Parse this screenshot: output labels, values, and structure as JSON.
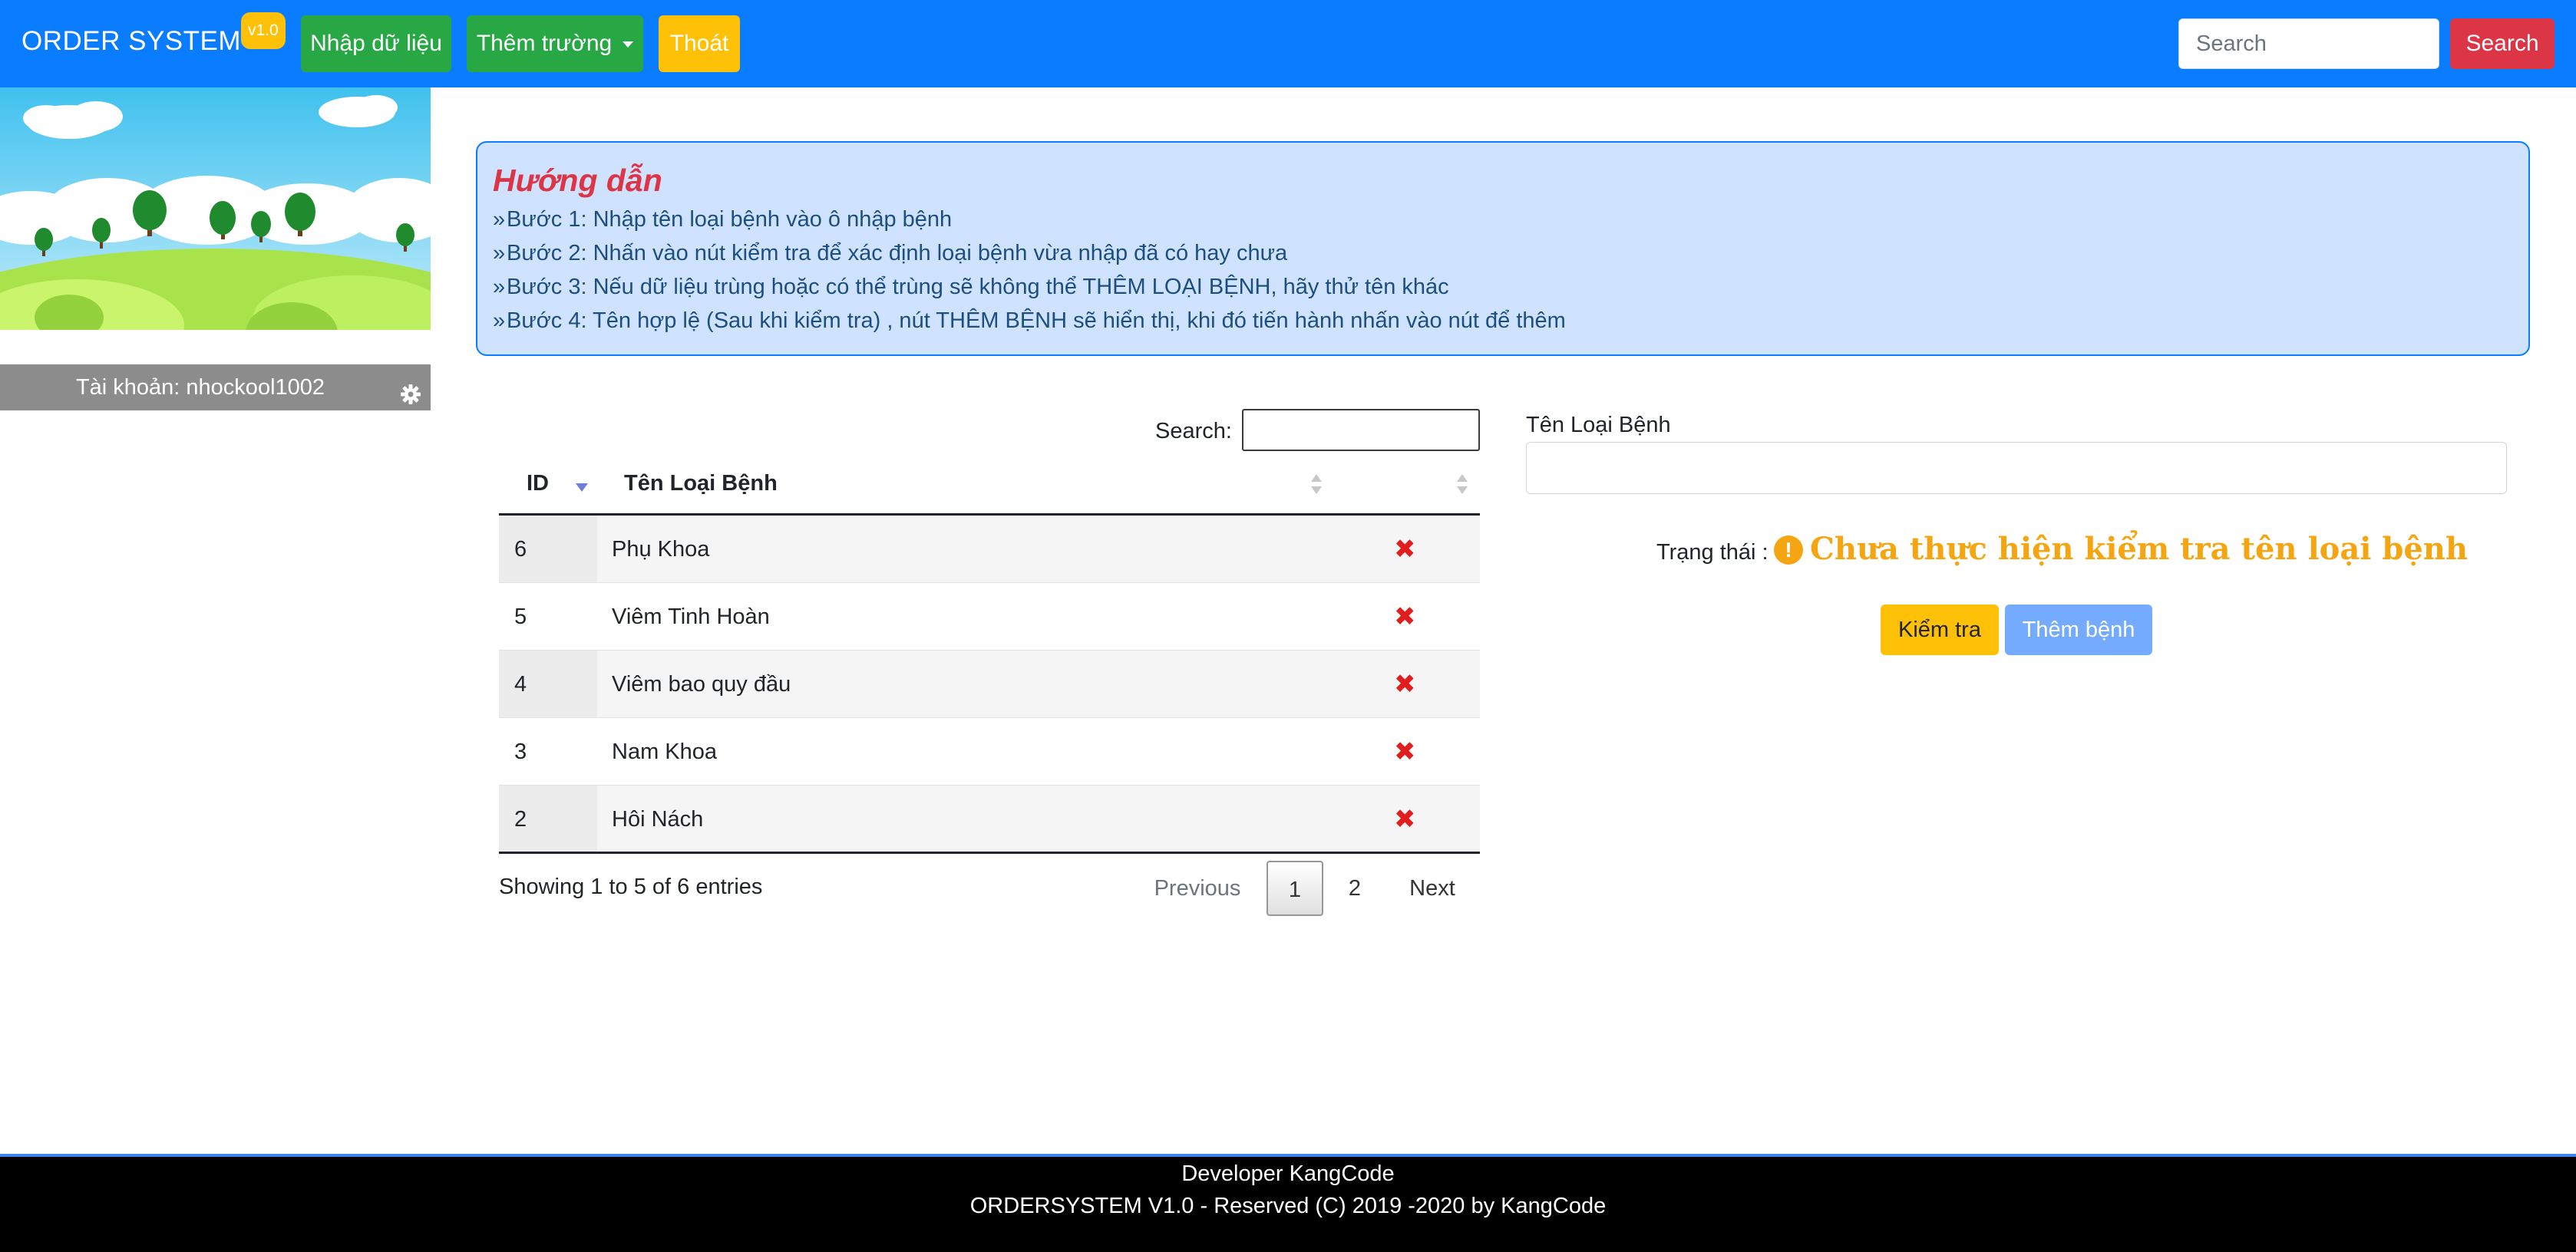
{
  "navbar": {
    "brand": "ORDER SYSTEM",
    "version": "v1.0",
    "nhap_du_lieu": "Nhập dữ liệu",
    "them_truong": "Thêm trường",
    "thoat": "Thoát",
    "search_placeholder": "Search",
    "search_button": "Search",
    "colors": {
      "bar": "#0a7cff",
      "green": "#28a745",
      "yellow": "#ffc107",
      "red": "#dc3545"
    }
  },
  "sidebar": {
    "account_label": "Tài khoản: nhockool1002",
    "settings_icon": "gear-icon"
  },
  "guide": {
    "title": "Hướng dẫn",
    "steps": [
      "Bước 1: Nhập tên loại bệnh vào ô nhập bệnh",
      "Bước 2: Nhấn vào nút kiểm tra để xác định loại bệnh vừa nhập đã có hay chưa",
      "Bước 3: Nếu dữ liệu trùng hoặc có thể trùng sẽ không thể THÊM LOẠI BỆNH, hãy thử tên khác",
      "Bước 4: Tên hợp lệ (Sau khi kiểm tra) , nút THÊM BỆNH sẽ hiển thị, khi đó tiến hành nhấn vào nút để thêm"
    ]
  },
  "table": {
    "search_label": "Search:",
    "columns": [
      "ID",
      "Tên Loại Bệnh",
      ""
    ],
    "rows": [
      {
        "id": "6",
        "name": "Phụ Khoa",
        "delete_icon": "delete-x-icon"
      },
      {
        "id": "5",
        "name": "Viêm Tinh Hoàn",
        "delete_icon": "delete-x-icon"
      },
      {
        "id": "4",
        "name": "Viêm bao quy đầu",
        "delete_icon": "delete-x-icon"
      },
      {
        "id": "3",
        "name": "Nam Khoa",
        "delete_icon": "delete-x-icon"
      },
      {
        "id": "2",
        "name": "Hôi Nách",
        "delete_icon": "delete-x-icon"
      }
    ],
    "info": "Showing 1 to 5 of 6 entries",
    "pagination": {
      "previous": "Previous",
      "pages": [
        "1",
        "2"
      ],
      "current": "1",
      "next": "Next"
    }
  },
  "form": {
    "label": "Tên Loại Bệnh",
    "input_value": "",
    "status_label": "Trạng thái :",
    "status_icon": "!",
    "status_text": "Chưa thực hiện kiểm tra tên loại bệnh",
    "check_button": "Kiểm tra",
    "add_button": "Thêm bệnh"
  },
  "footer": {
    "line1": "Developer KangCode",
    "line2": "ORDERSYSTEM V1.0 - Reserved (C) 2019 -2020 by KangCode"
  }
}
